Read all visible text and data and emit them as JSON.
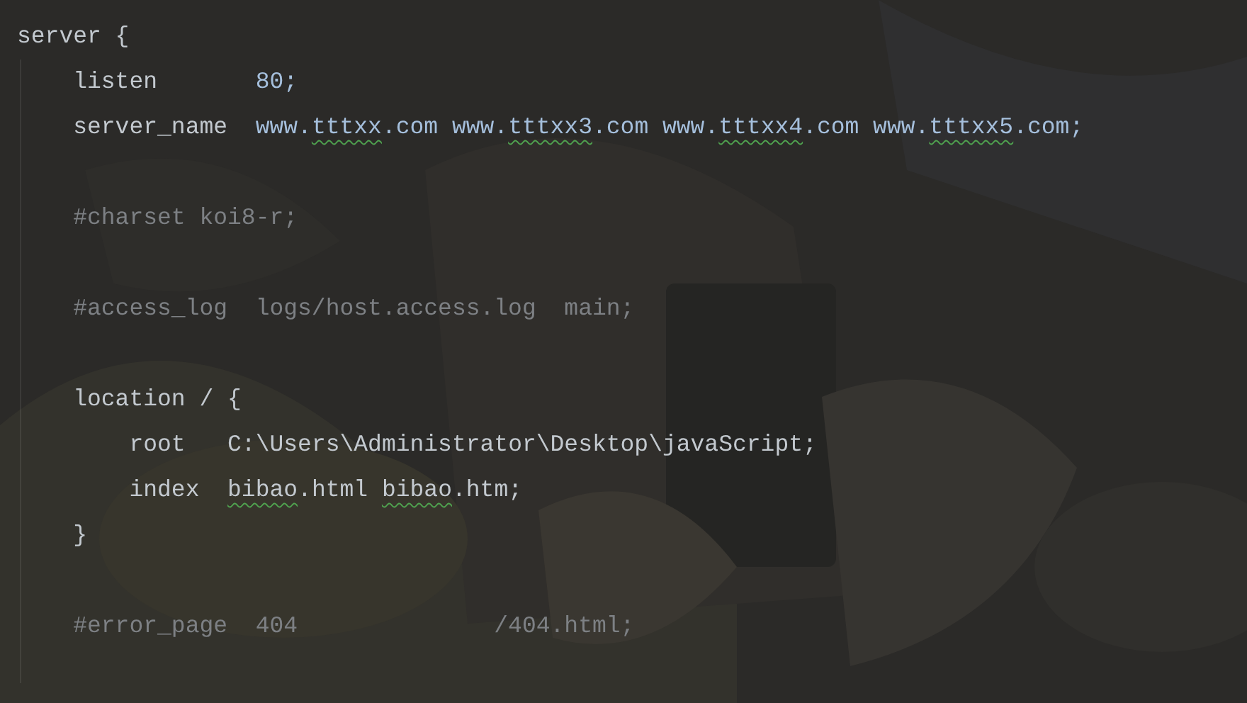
{
  "editor": {
    "lines": [
      {
        "kind": "code",
        "segments": [
          {
            "text": "server {",
            "kind": "key"
          }
        ]
      },
      {
        "kind": "code",
        "segments": [
          {
            "text": "    listen       ",
            "kind": "key"
          },
          {
            "text": "80;",
            "kind": "value"
          }
        ]
      },
      {
        "kind": "code",
        "segments": [
          {
            "text": "    server_name  ",
            "kind": "key"
          },
          {
            "text": "www.",
            "kind": "value"
          },
          {
            "text": "tttxx",
            "kind": "value",
            "typo": true
          },
          {
            "text": ".com www.",
            "kind": "value"
          },
          {
            "text": "tttxx3",
            "kind": "value",
            "typo": true
          },
          {
            "text": ".com www.",
            "kind": "value"
          },
          {
            "text": "tttxx4",
            "kind": "value",
            "typo": true
          },
          {
            "text": ".com www.",
            "kind": "value"
          },
          {
            "text": "tttxx5",
            "kind": "value",
            "typo": true
          },
          {
            "text": ".com;",
            "kind": "value"
          }
        ]
      },
      {
        "kind": "blank"
      },
      {
        "kind": "code",
        "segments": [
          {
            "text": "    #charset koi8-r;",
            "kind": "comment"
          }
        ]
      },
      {
        "kind": "blank"
      },
      {
        "kind": "code",
        "segments": [
          {
            "text": "    #access_log  logs/host.access.log  main;",
            "kind": "comment"
          }
        ]
      },
      {
        "kind": "blank"
      },
      {
        "kind": "code",
        "segments": [
          {
            "text": "    location / {",
            "kind": "key"
          }
        ]
      },
      {
        "kind": "code",
        "segments": [
          {
            "text": "        root   ",
            "kind": "key"
          },
          {
            "text": "C:\\Users\\Administrator\\Desktop\\javaScript;",
            "kind": "key"
          }
        ]
      },
      {
        "kind": "code",
        "segments": [
          {
            "text": "        index  ",
            "kind": "key"
          },
          {
            "text": "bibao",
            "kind": "key",
            "typo": true
          },
          {
            "text": ".html ",
            "kind": "key"
          },
          {
            "text": "bibao",
            "kind": "key",
            "typo": true
          },
          {
            "text": ".htm;",
            "kind": "key"
          }
        ]
      },
      {
        "kind": "code",
        "segments": [
          {
            "text": "    }",
            "kind": "key"
          }
        ]
      },
      {
        "kind": "blank"
      },
      {
        "kind": "code",
        "segments": [
          {
            "text": "    #error_page  404              /404.html;",
            "kind": "comment"
          }
        ]
      }
    ]
  }
}
